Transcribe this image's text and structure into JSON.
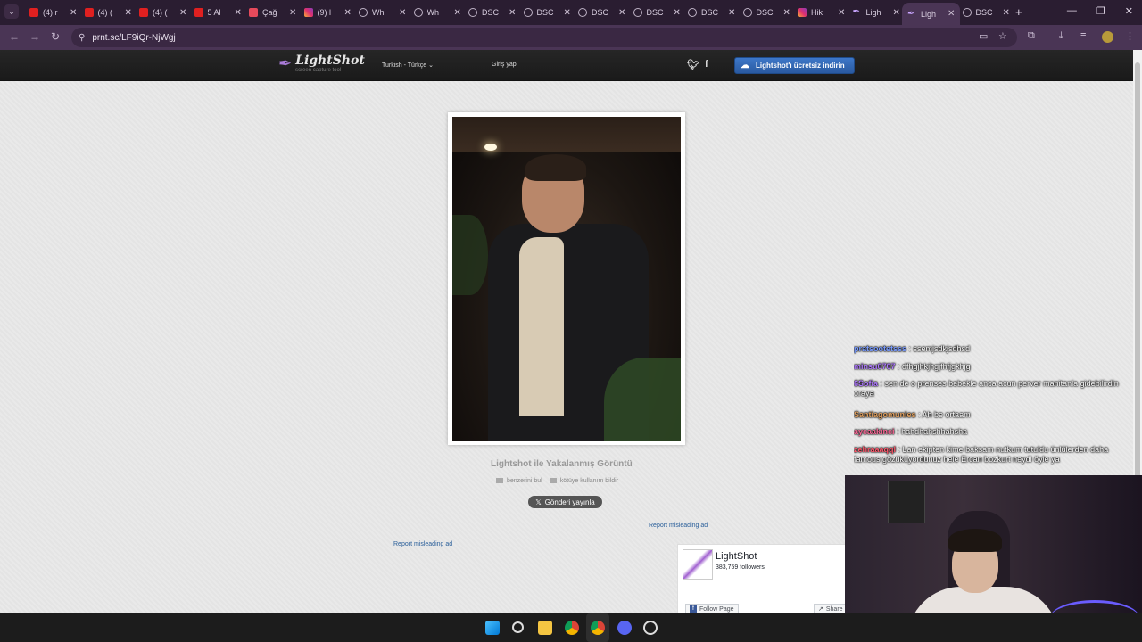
{
  "browser": {
    "tabs": [
      {
        "label": "(4) r",
        "icon": "youtube-icon"
      },
      {
        "label": "(4) (",
        "icon": "youtube-icon"
      },
      {
        "label": "(4) (",
        "icon": "youtube-icon"
      },
      {
        "label": "5 Al",
        "icon": "youtube-icon"
      },
      {
        "label": "Çağ",
        "icon": "music-icon"
      },
      {
        "label": "(9) l",
        "icon": "instagram-icon"
      },
      {
        "label": "Wh",
        "icon": "globe-icon"
      },
      {
        "label": "Wh",
        "icon": "globe-icon"
      },
      {
        "label": "DSC",
        "icon": "globe-icon"
      },
      {
        "label": "DSC",
        "icon": "globe-icon"
      },
      {
        "label": "DSC",
        "icon": "globe-icon"
      },
      {
        "label": "DSC",
        "icon": "globe-icon"
      },
      {
        "label": "DSC",
        "icon": "globe-icon"
      },
      {
        "label": "DSC",
        "icon": "globe-icon"
      },
      {
        "label": "Hik",
        "icon": "instagram-icon"
      },
      {
        "label": "Ligh",
        "icon": "feather-icon"
      },
      {
        "label": "Ligh",
        "icon": "feather-icon",
        "active": true
      },
      {
        "label": "DSC",
        "icon": "globe-icon"
      }
    ],
    "url": "prnt.sc/LF9iQr-NjWgj"
  },
  "lightshot": {
    "logo_name": "LightShot",
    "logo_tagline": "screen capture tool",
    "language": "Turkish - Türkçe",
    "login": "Giriş yap",
    "download_button": "Lightshot'ı ücretsiz indirin",
    "caption": "Lightshot ile Yakalanmış Görüntü",
    "find_similar": "benzerini bul",
    "report_abuse": "kötüye kullanım bildir",
    "tweet_button": "Gönderi yayınla",
    "report_ad_1": "Report misleading ad",
    "report_ad_2": "Report misleading ad"
  },
  "facebook_widget": {
    "page_name": "LightShot",
    "followers": "383,759 followers",
    "follow_button": "Follow Page",
    "share_button": "Share"
  },
  "chat": {
    "messages": [
      {
        "user": "pratsootetsss",
        "text": ": ssemjsdkjsdhsd",
        "color": "#7a9cff"
      },
      {
        "user": "minsu0707",
        "text": ": dfhgjhkjhgjfhfjgkhjg",
        "color": "#b07aff"
      },
      {
        "user": "6Sofia",
        "text": ": sen de o prenses bebekle anca acun perver manitanla gidebilirdin oraya",
        "color": "#b07aff"
      },
      {
        "user": "Santiagomunies",
        "text": ": Ah be ortaam",
        "color": "#e0a060"
      },
      {
        "user": "aycaakinci",
        "text": ": hahdhahshhahsha",
        "color": "#ff6b9a"
      },
      {
        "user": "zehraaaqql",
        "text": ": Lan ekipten kime baksam nutkum tutuldu ünlülerden daha famous gözüküyordunuz hele Ercan bozkurt neydi öyle ya",
        "color": "#ff5a6e"
      }
    ]
  },
  "colors": {
    "accent": "#2a5aa0",
    "link": "#2a5f9a",
    "browser_frame": "#4a3555"
  }
}
